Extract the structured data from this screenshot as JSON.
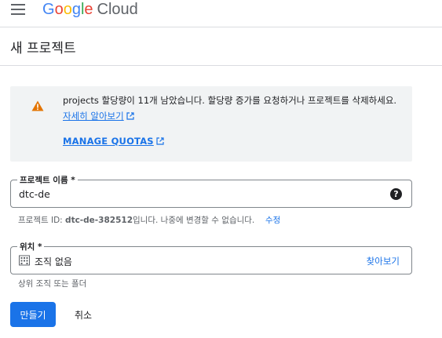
{
  "header": {
    "logo": {
      "google": [
        "G",
        "o",
        "o",
        "g",
        "l",
        "e"
      ],
      "product": "Cloud"
    },
    "menu_icon": "hamburger-menu-icon"
  },
  "page": {
    "title": "새 프로젝트"
  },
  "quota_warning": {
    "icon": "warning-icon",
    "icon_color": "#e37400",
    "text": "projects 할당량이 11개 남았습니다. 할당량 증가를 요청하거나 프로젝트를 삭제하세요. ",
    "learn_more_label": "자세히 알아보기",
    "manage_quotas_label": "MANAGE QUOTAS"
  },
  "project_name": {
    "label": "프로젝트 이름 *",
    "value": "dtc-de",
    "help_icon": "help-circle-icon",
    "hint_prefix": "프로젝트 ID: ",
    "project_id": "dtc-de-382512",
    "hint_suffix": "입니다. 나중에 변경할 수 없습니다.",
    "edit_label": "수정"
  },
  "location": {
    "label": "위치 *",
    "value": "조직 없음",
    "icon": "organization-icon",
    "browse_label": "찾아보기",
    "hint": "상위 조직 또는 폴더"
  },
  "actions": {
    "create_label": "만들기",
    "cancel_label": "취소"
  },
  "colors": {
    "accent": "#1a73e8",
    "card_bg": "#f1f3f4",
    "warning": "#e37400"
  }
}
